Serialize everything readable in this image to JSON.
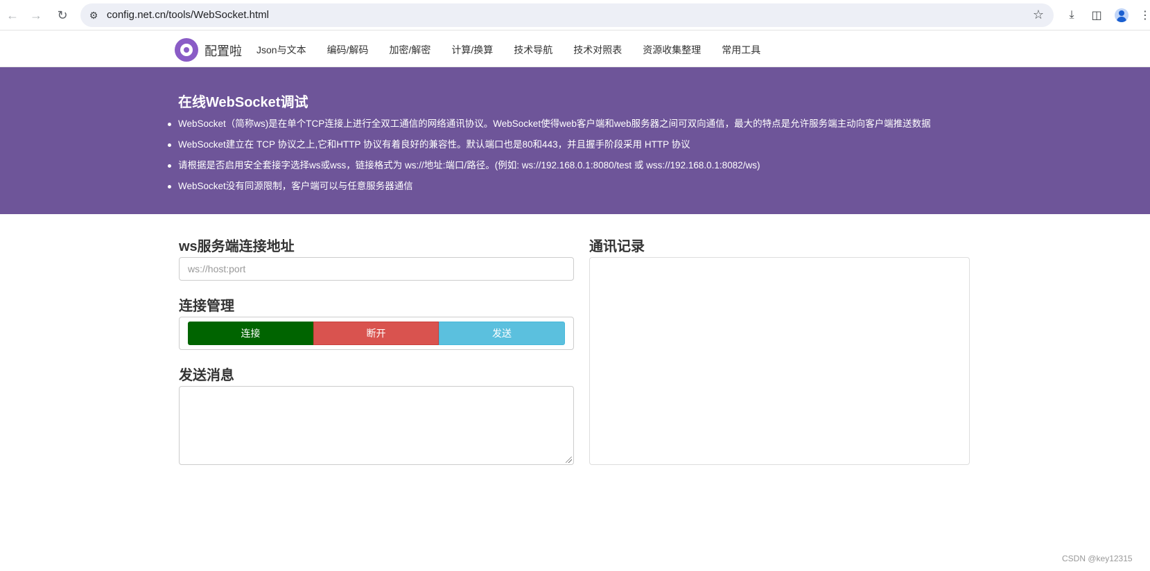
{
  "browser": {
    "url": "config.net.cn/tools/WebSocket.html",
    "icons": [
      "back-arrow-icon",
      "forward-arrow-icon",
      "reload-icon",
      "site-info-icon",
      "bookmark-star-icon",
      "download-icon",
      "side-panel-icon",
      "profile-icon",
      "menu-dots-icon"
    ]
  },
  "navbar": {
    "brand": "配置啦",
    "links": [
      "Json与文本",
      "编码/解码",
      "加密/解密",
      "计算/换算",
      "技术导航",
      "技术对照表",
      "资源收集整理",
      "常用工具"
    ]
  },
  "hero": {
    "title": "在线WebSocket调试",
    "items": [
      "WebSocket（简称ws)是在单个TCP连接上进行全双工通信的网络通讯协议。WebSocket使得web客户端和web服务器之间可双向通信，最大的特点是允许服务端主动向客户端推送数据",
      "WebSocket建立在 TCP 协议之上,它和HTTP 协议有着良好的兼容性。默认端口也是80和443，并且握手阶段采用 HTTP 协议",
      "请根据是否启用安全套接字选择ws或wss，链接格式为 ws://地址:端口/路径。(例如: ws://192.168.0.1:8080/test 或 wss://192.168.0.1:8082/ws)",
      "WebSocket没有同源限制，客户端可以与任意服务器通信"
    ]
  },
  "main": {
    "ws_heading": "ws服务端连接地址",
    "ws_placeholder": "ws://host:port",
    "ws_value": "",
    "manage_heading": "连接管理",
    "buttons": {
      "connect": "连接",
      "disconnect": "断开",
      "send": "发送"
    },
    "message_heading": "发送消息",
    "message_value": "",
    "log_heading": "通讯记录"
  },
  "colors": {
    "hero_bg": "#6e5599",
    "connect": "#006400",
    "disconnect": "#d9534f",
    "send": "#5bc0de"
  },
  "watermark": "CSDN @key12315"
}
